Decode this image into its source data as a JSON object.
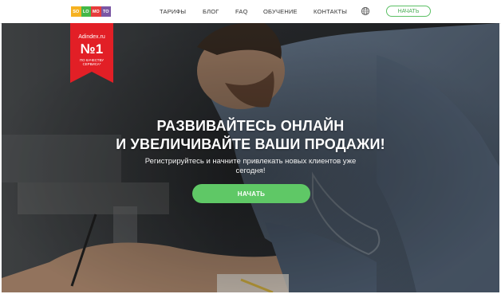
{
  "brand": {
    "logo_letters": [
      "SO",
      "LO",
      "MO",
      "TO"
    ],
    "logo_colors": [
      "#f6b221",
      "#44b848",
      "#e73c3c",
      "#7b57a4"
    ]
  },
  "nav": {
    "items": [
      "ТАРИФЫ",
      "БЛОГ",
      "FAQ",
      "ОБУЧЕНИЕ",
      "КОНТАКТЫ"
    ],
    "language_icon": "globe-icon",
    "cta": "НАЧАТЬ"
  },
  "ribbon": {
    "brand": "Adindex.ru",
    "rank": "№1",
    "caption_line1": "по качеству",
    "caption_line2": "сервиса*",
    "color": "#e21f26"
  },
  "hero": {
    "headline_line1": "РАЗВИВАЙТЕСЬ ОНЛАЙН",
    "headline_line2": "И УВЕЛИЧИВАЙТЕ ВАШИ ПРОДАЖИ!",
    "subline": "Регистрируйтесь и начните привлекать новых клиентов уже сегодня!",
    "cta": "НАЧАТЬ",
    "accent": "#5fc866"
  }
}
